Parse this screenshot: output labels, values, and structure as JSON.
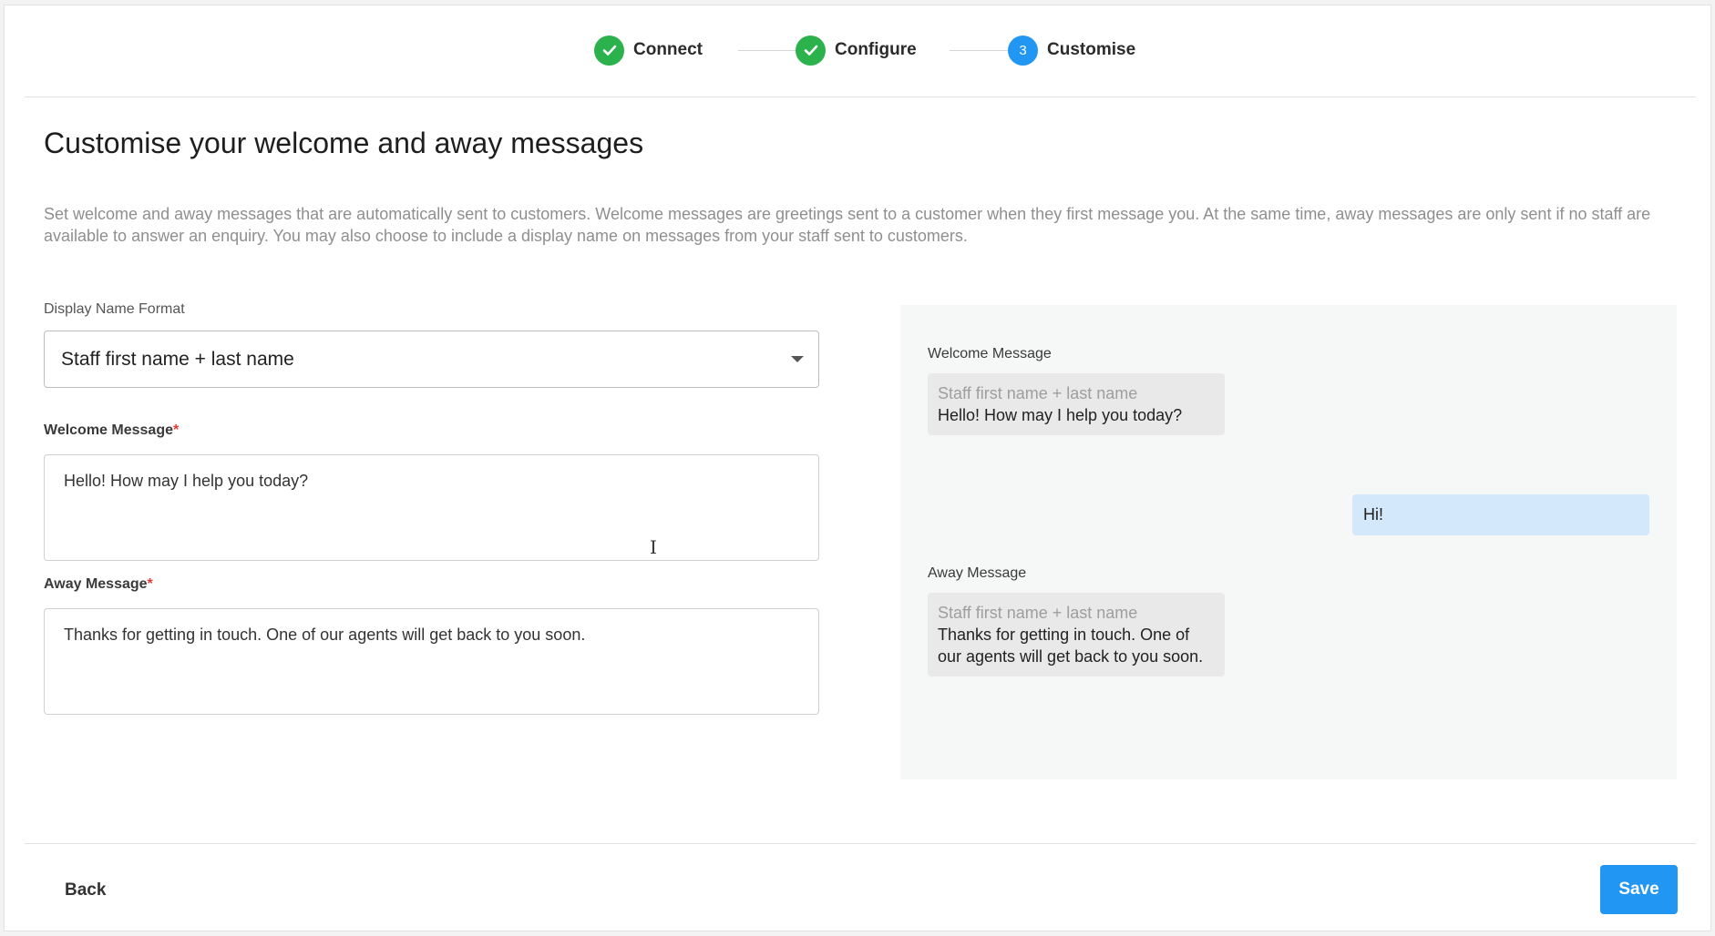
{
  "stepper": {
    "steps": [
      {
        "label": "Connect",
        "status": "done"
      },
      {
        "label": "Configure",
        "status": "done"
      },
      {
        "label": "Customise",
        "status": "active",
        "number": "3"
      }
    ]
  },
  "page": {
    "title": "Customise your welcome and away messages",
    "description": "Set welcome and away messages that are automatically sent to customers. Welcome messages are greetings sent to a customer when they first message you. At the same time, away messages are only sent if no staff are available to answer an enquiry. You may also choose to include a display name on messages from your staff sent to customers."
  },
  "form": {
    "display_name_label": "Display Name Format",
    "display_name_value": "Staff first name + last name",
    "welcome_label": "Welcome Message",
    "welcome_value": "Hello! How may I help you today?",
    "away_label": "Away Message",
    "away_value": "Thanks for getting in touch. One of our agents will get back to you soon.",
    "required_mark": "*"
  },
  "preview": {
    "welcome_label": "Welcome Message",
    "welcome_sender": "Staff first name + last name",
    "welcome_text": "Hello! How may I help you today?",
    "customer_reply": "Hi!",
    "away_label": "Away Message",
    "away_sender": "Staff first name + last name",
    "away_text": "Thanks for getting in touch. One of our agents will get back to you soon."
  },
  "footer": {
    "back_label": "Back",
    "save_label": "Save"
  },
  "colors": {
    "accent": "#2196f3",
    "success": "#2bb24c",
    "required": "#e53935"
  }
}
